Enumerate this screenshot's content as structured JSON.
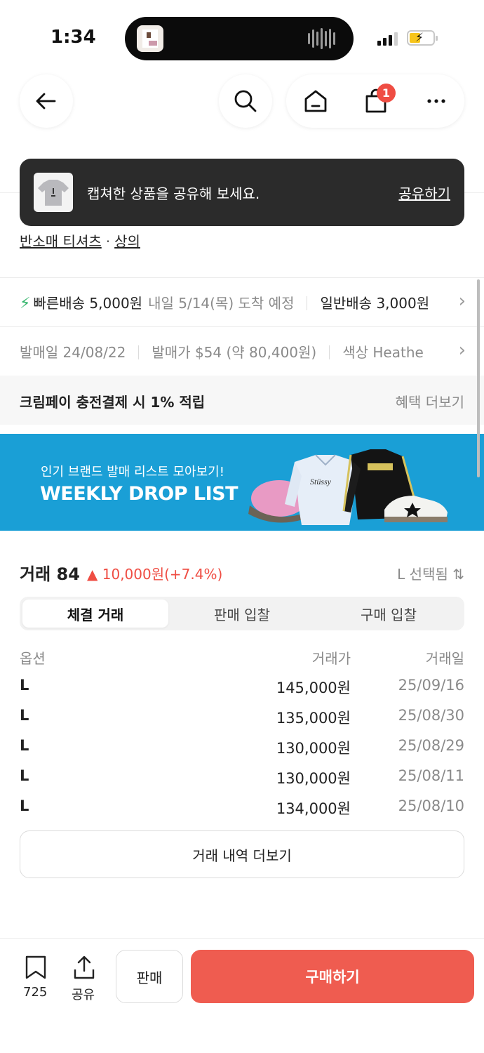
{
  "status_bar": {
    "time": "1:34"
  },
  "nav": {
    "cart_count": "1"
  },
  "toast": {
    "message": "캡쳐한 상품을 공유해 보세요.",
    "action": "공유하기"
  },
  "breadcrumb": {
    "category": "반소매 티셔츠",
    "separator": "·",
    "parent": "상의"
  },
  "shipping": {
    "fast_label": "빠른배송",
    "fast_price": "5,000원",
    "fast_eta": "내일 5/14(목) 도착 예정",
    "normal_label": "일반배송",
    "normal_price": "3,000원"
  },
  "release": {
    "date": "발매일 24/08/22",
    "price": "발매가 $54 (약 80,400원)",
    "color": "색상 Heathe"
  },
  "benefit": {
    "text": "크림페이 충전결제 시 1% 적립",
    "more": "혜택 더보기"
  },
  "banner": {
    "subtitle": "인기 브랜드 발매 리스트 모아보기!",
    "title": "WEEKLY DROP LIST"
  },
  "trade": {
    "title": "거래 84",
    "change": "▲ 10,000원(+7.4%)",
    "selected": "L 선택됨 ⇅",
    "tabs": [
      "체결 거래",
      "판매 입찰",
      "구매 입찰"
    ],
    "headers": {
      "option": "옵션",
      "price": "거래가",
      "date": "거래일"
    },
    "rows": [
      {
        "option": "L",
        "price": "145,000원",
        "date": "25/09/16"
      },
      {
        "option": "L",
        "price": "135,000원",
        "date": "25/08/30"
      },
      {
        "option": "L",
        "price": "130,000원",
        "date": "25/08/29"
      },
      {
        "option": "L",
        "price": "130,000원",
        "date": "25/08/11"
      },
      {
        "option": "L",
        "price": "134,000원",
        "date": "25/08/10"
      }
    ],
    "more": "거래 내역 더보기"
  },
  "bottom": {
    "bookmark_count": "725",
    "share_label": "공유",
    "sell": "판매",
    "buy": "구매하기"
  },
  "colors": {
    "accent": "#ef5c50",
    "up": "#ef4d43",
    "fast": "#31b46a",
    "banner": "#1a9fd6"
  },
  "icons": [
    "back-icon",
    "search-icon",
    "home-icon",
    "bag-icon",
    "more-icon",
    "bolt-icon",
    "chevron-right-icon",
    "bookmark-icon",
    "share-icon"
  ]
}
